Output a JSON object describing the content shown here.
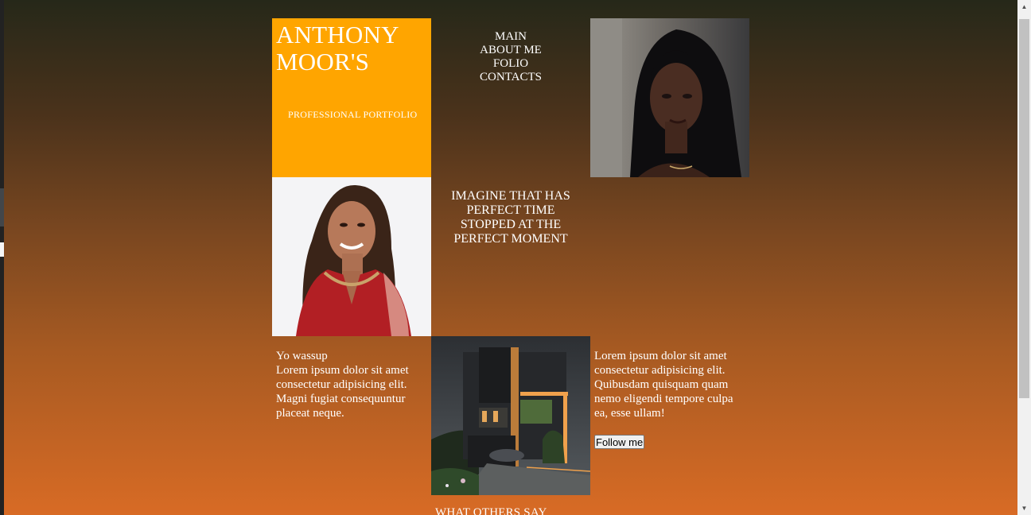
{
  "header": {
    "title": "ANTHONY MOOR'S",
    "subtitle": "PROFESSIONAL PORTFOLIO"
  },
  "nav": {
    "items": [
      {
        "label": "MAIN"
      },
      {
        "label": "ABOUT ME"
      },
      {
        "label": "FOLIO"
      },
      {
        "label": "CONTACTS"
      }
    ]
  },
  "quote": {
    "text": "IMAGINE THAT HAS PERFECT TIME STOPPED AT THE PERFECT MOMENT"
  },
  "left_text": {
    "heading": "Yo wassup",
    "body": "Lorem ipsum dolor sit amet consectetur adipisicing elit. Magni fugiat consequuntur placeat neque."
  },
  "right_text": {
    "body": "Lorem ipsum dolor sit amet consectetur adipisicing elit. Quibusdam quisquam quam nemo eligendi tempore culpa ea, esse ullam!",
    "button_label": "Follow me"
  },
  "section": {
    "others_heading": "WHAT OTHERS SAY"
  },
  "colors": {
    "accent": "#ffa500",
    "gradient_top": "#262819",
    "gradient_bottom": "#d86b25"
  },
  "icons": {
    "scroll_up": "scroll-up-arrow-icon",
    "scroll_down": "scroll-down-arrow-icon"
  }
}
